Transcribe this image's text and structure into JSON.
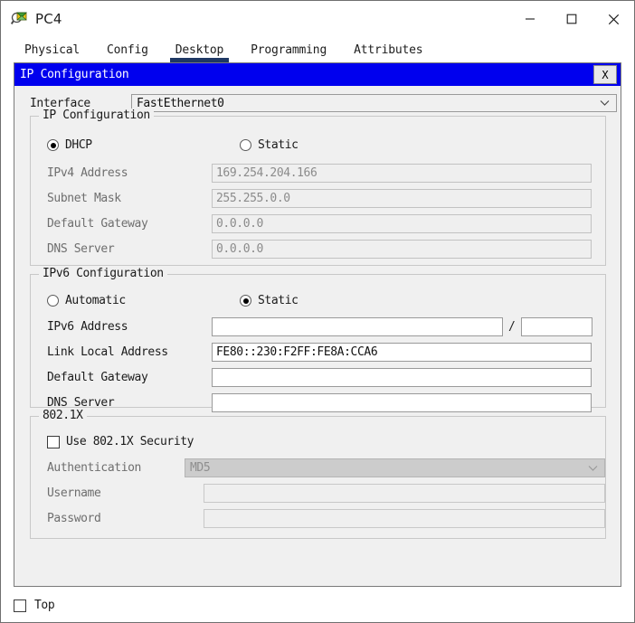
{
  "window": {
    "title": "PC4",
    "icon": "packet-tracer-pc-icon",
    "controls": {
      "minimize": "minimize-icon",
      "maximize": "maximize-icon",
      "close": "close-icon"
    }
  },
  "tabs": [
    {
      "label": "Physical",
      "active": false
    },
    {
      "label": "Config",
      "active": false
    },
    {
      "label": "Desktop",
      "active": true
    },
    {
      "label": "Programming",
      "active": false
    },
    {
      "label": "Attributes",
      "active": false
    }
  ],
  "dialog": {
    "caption": "IP Configuration",
    "caption_bg": "#0000ee",
    "close_label": "X"
  },
  "interface": {
    "label": "Interface",
    "value": "FastEthernet0",
    "chevron": "chevron-down-icon"
  },
  "ip_configuration": {
    "group_title": "IP Configuration",
    "mode": {
      "dhcp_label": "DHCP",
      "dhcp_selected": true,
      "static_label": "Static",
      "static_selected": false
    },
    "fields": [
      {
        "label": "IPv4 Address",
        "value": "169.254.204.166",
        "disabled": true
      },
      {
        "label": "Subnet Mask",
        "value": "255.255.0.0",
        "disabled": true
      },
      {
        "label": "Default Gateway",
        "value": "0.0.0.0",
        "disabled": true
      },
      {
        "label": "DNS Server",
        "value": "0.0.0.0",
        "disabled": true
      }
    ]
  },
  "ipv6_configuration": {
    "group_title": "IPv6 Configuration",
    "mode": {
      "automatic_label": "Automatic",
      "automatic_selected": false,
      "static_label": "Static",
      "static_selected": true
    },
    "ipv6_address": {
      "label": "IPv6 Address",
      "value": "",
      "prefix": "",
      "separator": "/"
    },
    "fields": [
      {
        "label": "Link Local Address",
        "value": "FE80::230:F2FF:FE8A:CCA6",
        "disabled": false
      },
      {
        "label": "Default Gateway",
        "value": "",
        "disabled": false
      },
      {
        "label": "DNS Server",
        "value": "",
        "disabled": false
      }
    ]
  },
  "dot1x": {
    "group_title": "802.1X",
    "use_security_label": "Use 802.1X Security",
    "use_security_checked": false,
    "authentication": {
      "label": "Authentication",
      "value": "MD5",
      "disabled": true,
      "chevron": "chevron-down-icon"
    },
    "username": {
      "label": "Username",
      "value": "",
      "disabled": true
    },
    "password": {
      "label": "Password",
      "value": "",
      "disabled": true
    }
  },
  "bottom": {
    "top_label": "Top",
    "top_checked": false
  }
}
